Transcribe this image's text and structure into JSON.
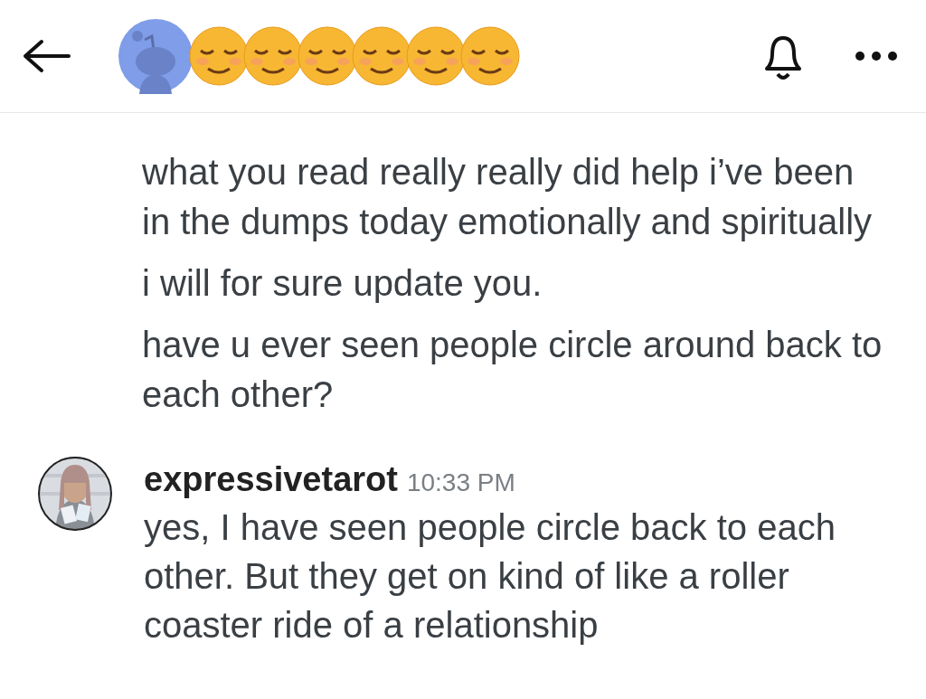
{
  "header": {
    "emojis": [
      {
        "kind": "smiling"
      },
      {
        "kind": "smiling"
      },
      {
        "kind": "smiling"
      },
      {
        "kind": "smiling"
      },
      {
        "kind": "smiling"
      },
      {
        "kind": "smiling"
      }
    ]
  },
  "earlier_messages": [
    {
      "text": "what you read really really did help i’ve been in the dumps today emotionally and spiritually"
    },
    {
      "text": "i will for sure update you."
    },
    {
      "text": "have u ever seen people circle around back to each other?"
    }
  ],
  "reply": {
    "username": "expressivetarot",
    "time": "10:33 PM",
    "text": "yes, I have seen people circle back to each other. But they get on kind of like a roller coaster ride of a relationship"
  }
}
